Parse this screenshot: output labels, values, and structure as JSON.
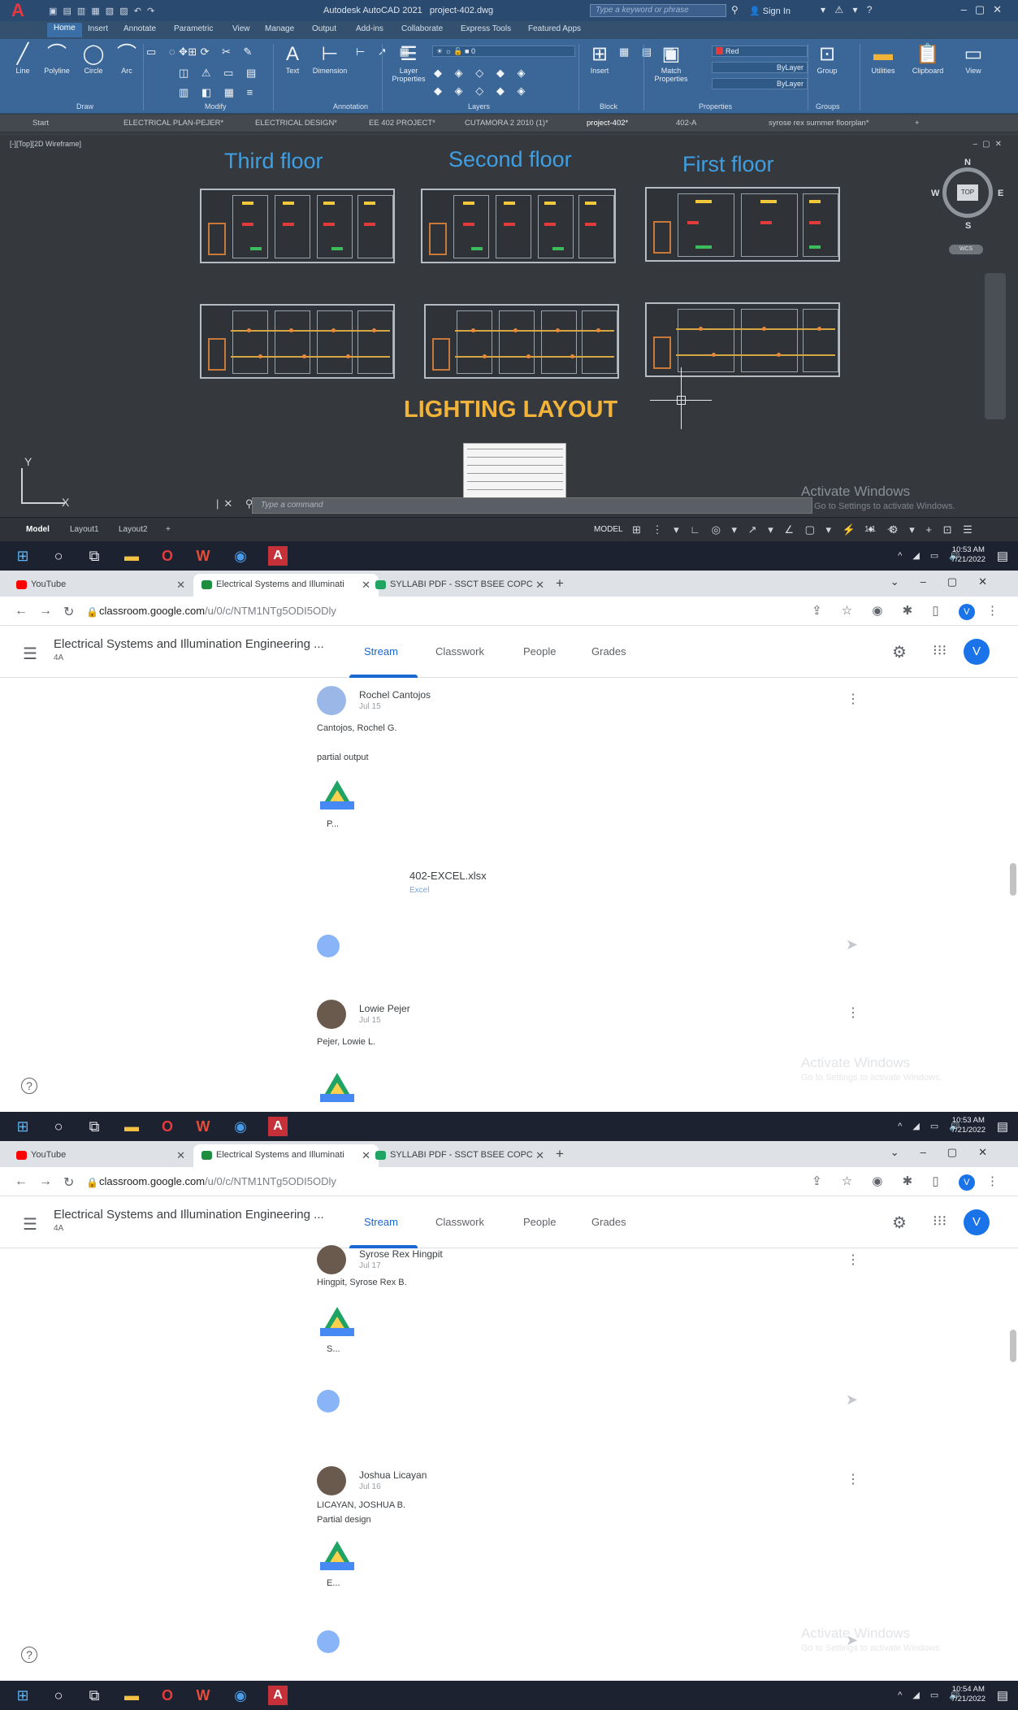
{
  "acad": {
    "app_title": "Autodesk AutoCAD 2021",
    "file_title": "project-402.dwg",
    "search_placeholder": "Type a keyword or phrase",
    "sign_in": "Sign In",
    "ribbon_tabs": [
      "Home",
      "Insert",
      "Annotate",
      "Parametric",
      "View",
      "Manage",
      "Output",
      "Add-ins",
      "Collaborate",
      "Express Tools",
      "Featured Apps"
    ],
    "draw_tools": [
      "Line",
      "Polyline",
      "Circle",
      "Arc"
    ],
    "annotation_tools": [
      "Text",
      "Dimension"
    ],
    "layer_properties": "Layer Properties",
    "layer_value": "0",
    "insert_label": "Insert",
    "match_properties": "Match Properties",
    "color_value": "Red",
    "linetype_value": "ByLayer",
    "lineweight_value": "ByLayer",
    "group_label": "Group",
    "utilities_label": "Utilities",
    "clipboard_label": "Clipboard",
    "view_label": "View",
    "groups": [
      "Draw",
      "Modify",
      "Annotation",
      "Layers",
      "Block",
      "Properties",
      "Groups"
    ],
    "file_tabs": [
      "Start",
      "ELECTRICAL PLAN-PEJER*",
      "ELECTRICAL DESIGN*",
      "EE 402 PROJECT*",
      "CUTAMORA 2 2010 (1)*",
      "project-402*",
      "402-A",
      "syrose rex summer floorplan*"
    ],
    "viewport_label": "[-][Top][2D Wireframe]",
    "floor_titles": [
      "Third floor",
      "Second floor",
      "First floor"
    ],
    "lighting_title": "LIGHTING LAYOUT",
    "compass": {
      "n": "N",
      "s": "S",
      "e": "E",
      "w": "W",
      "top": "TOP",
      "wcs": "WCS"
    },
    "ucs": {
      "y": "Y",
      "x": "X"
    },
    "command_placeholder": "Type a command",
    "activate_title": "Activate Windows",
    "activate_sub": "Go to Settings to activate Windows.",
    "layout_tabs": [
      "Model",
      "Layout1",
      "Layout2"
    ],
    "model_label": "MODEL",
    "scale": "1:1"
  },
  "taskbars": [
    {
      "time": "10:53 AM",
      "date": "7/21/2022"
    },
    {
      "time": "10:53 AM",
      "date": "7/21/2022"
    },
    {
      "time": "10:54 AM",
      "date": "7/21/2022"
    }
  ],
  "browser": {
    "tabs": [
      "YouTube",
      "Electrical Systems and Illuminati",
      "SYLLABI PDF - SSCT BSEE COPC"
    ],
    "url_host": "classroom.google.com",
    "url_path": "/u/0/c/NTM1NTg5ODI5ODly",
    "avatar_letter": "V",
    "course_title": "Electrical Systems and Illumination Engineering ...",
    "section": "4A",
    "nav_tabs": [
      "Stream",
      "Classwork",
      "People",
      "Grades"
    ]
  },
  "stream_top": {
    "posts": [
      {
        "name": "Rochel Cantojos",
        "date": "Jul 15",
        "lines": [
          "Cantojos, Rochel G.",
          "partial output"
        ],
        "drive_file": "P...",
        "attachment_title": "402-EXCEL.xlsx",
        "attachment_type": "Excel"
      },
      {
        "name": "Lowie Pejer",
        "date": "Jul 15",
        "lines": [
          "Pejer, Lowie L."
        ],
        "drive_file": ""
      }
    ]
  },
  "stream_bottom": {
    "posts": [
      {
        "name": "Syrose Rex Hingpit",
        "date": "Jul 17",
        "lines": [
          "Hingpit, Syrose Rex B."
        ],
        "drive_file": "S..."
      },
      {
        "name": "Joshua Licayan",
        "date": "Jul 16",
        "lines": [
          "LICAYAN, JOSHUA B.",
          "Partial design"
        ],
        "drive_file": "E..."
      }
    ]
  },
  "watermark": {
    "title": "Activate Windows",
    "sub": "Go to Settings to activate Windows."
  }
}
